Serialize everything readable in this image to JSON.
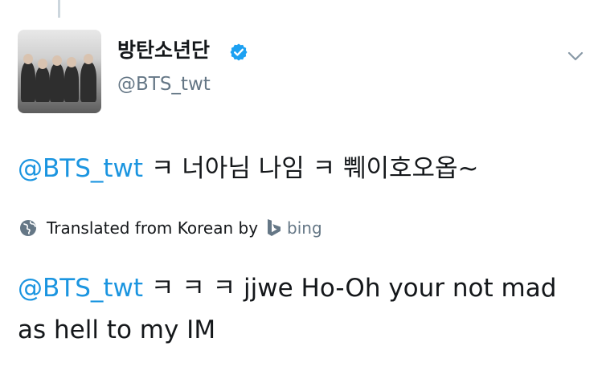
{
  "tweet": {
    "author_name": "방탄소년단",
    "handle": "@BTS_twt",
    "text_mention": "@BTS_twt",
    "text_body": " ㅋ 너아님 나임 ㅋ 쀄이호오옵~",
    "translation_label": "Translated from Korean by",
    "translation_provider": "bing",
    "translation_mention": "@BTS_twt",
    "translation_body": " ㅋ ㅋ ㅋ jjwe Ho-Oh your not mad as hell to my IM"
  },
  "icons": {
    "verified": "verified-badge-icon",
    "more": "chevron-down-icon",
    "globe": "globe-icon",
    "bing": "bing-logo-icon"
  },
  "colors": {
    "link": "#1b95e0",
    "verified": "#1da1f2",
    "secondary": "#657786",
    "text": "#14171a"
  }
}
